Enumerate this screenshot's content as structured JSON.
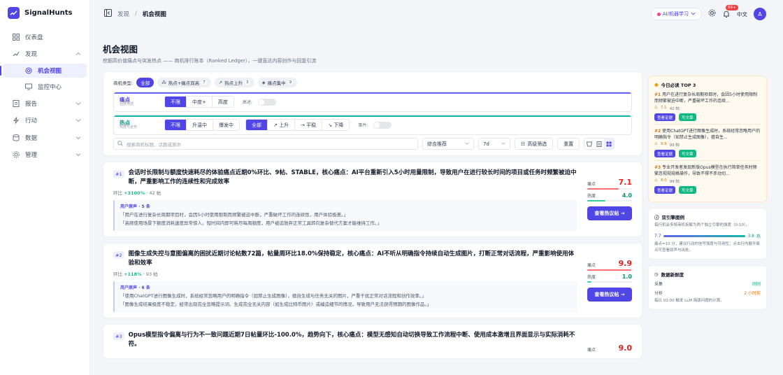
{
  "brand": {
    "name": "SignalHunts"
  },
  "sidebar": {
    "items": [
      {
        "label": "仪表盘",
        "icon": "grid-icon"
      },
      {
        "label": "发现",
        "icon": "trend-icon"
      },
      {
        "label": "机会视图",
        "icon": "target-icon"
      },
      {
        "label": "监控中心",
        "icon": "monitor-icon"
      },
      {
        "label": "报告",
        "icon": "report-icon"
      },
      {
        "label": "行动",
        "icon": "action-icon"
      },
      {
        "label": "数据",
        "icon": "database-icon"
      },
      {
        "label": "管理",
        "icon": "settings-icon"
      }
    ]
  },
  "topbar": {
    "crumb_parent": "发现",
    "crumb_sep": "/",
    "crumb_current": "机会视图",
    "topic": "AI/机器学习",
    "notif_count": "99+",
    "lang": "中文",
    "avatar": "A"
  },
  "page": {
    "title": "机会视图",
    "subtitle": "挖掘高价值痛点与突发热点 —— 商机排行账本（Ranked Ledger），一键直达内容创作与回复引流"
  },
  "filters": {
    "type_label": "商机类型:",
    "types": [
      {
        "label": "全部",
        "count": ""
      },
      {
        "label": "热点+痛点双高",
        "count": "7"
      },
      {
        "label": "热点上升",
        "count": "3"
      },
      {
        "label": "痛点集中",
        "count": "9"
      }
    ],
    "pain": {
      "title": "痛点",
      "sub": "强度筛选",
      "options": [
        "不限",
        "中度+",
        "高度"
      ],
      "toggle_label": "高述:",
      "toggle_text": "不限"
    },
    "hot": {
      "title": "热点",
      "sub": "热度与走势",
      "options": [
        "不限",
        "升温中",
        "爆发中"
      ],
      "trend": [
        "全部",
        "↗ 上升",
        "→ 平稳",
        "↘ 下降"
      ],
      "toggle_label": "事件:",
      "toggle_text": "不限"
    },
    "search_placeholder": "搜索商机标题、话题或原声",
    "sort": "综合推荐",
    "range": "7d",
    "advanced": "高级筛选",
    "reset": "重置"
  },
  "cards": [
    {
      "rank": "#1",
      "title": "会话时长限制与额度快速耗尽的体验痛点近期0%环比、9帖、STABLE，核心痛点：AI平台重新引入5小时用量限制，导致用户在进行较长时间的项目或任务时频繁被迫中断，严重影响工作的连续性和完成效率",
      "change_label": "环比",
      "change": "+3100%",
      "posts": "42 帖",
      "voices_title": "用户原声 · 5 条",
      "quotes": [
        "「用户在进行复杂长周期项目时，会因5小时使用限制而频繁被迫中断，严重破坏工作的连续性，用户体验极差。」",
        "「高频使用场景下额度消耗速度异常惊人。短时间内即可耗尽每周额度，用户被迫放弃正常工具转向复杂替代方案才能维持工作。」"
      ],
      "pain_label": "痛点",
      "pain": "7.1",
      "pain_pct": 71,
      "hot_label": "热度",
      "hot": "4.0",
      "hot_pct": 40,
      "cta": "查看热议帖 →"
    },
    {
      "rank": "#2",
      "title": "图像生成失控与意图偏离的困扰近期讨论帖数72篇，帖量周环比18.0%保持稳定，核心痛点：AI不听从明确指令持续自动生成图片，打断正常对话流程，严重影响使用体验和效率",
      "change_label": "环比",
      "change": "+118%",
      "posts": "93 帖",
      "voices_title": "用户原声 · 6 条",
      "quotes": [
        "「使用ChatGPT进行图像生成时，系统经常忽略用户的明确指令（如禁止生成图像），擅自生成与任务无关的图片，严重干扰正常对话流程和创作效率。」",
        "「图像生成结果极度不稳定，经常出现完全忽略提示词、生成完全无关内容（如生成比特币图片）或编造细节的情况，导致用户无法获得预期的图像作品。」"
      ],
      "pain_label": "痛点",
      "pain": "9.9",
      "pain_pct": 99,
      "hot_label": "热度",
      "hot": "1.0",
      "hot_pct": 10,
      "cta": "查看热议帖 →"
    },
    {
      "rank": "#3",
      "title": "Opus模型指令偏离与行为不一致问题近期7日帖量环比-100.0%，趋势向下，核心痛点：模型无感知自动切换导致工作流程中断、使用成本激增且界面显示与实际消耗不符。",
      "change_label": "",
      "change": "",
      "posts": "",
      "voices_title": "",
      "quotes": [],
      "pain_label": "痛点",
      "pain": "9.0",
      "pain_pct": 90,
      "hot_label": "",
      "hot": "",
      "hot_pct": 0,
      "cta": ""
    }
  ],
  "right": {
    "top3": {
      "title": "今日必读 TOP 3",
      "items": [
        {
          "rank": "#1",
          "text": "用户在进行复杂长周期项目时，会因5小时使用限制而频繁被迫中断，严重破坏工作的连续...",
          "pain": "7.1",
          "posts": "42 帖"
        },
        {
          "rank": "#2",
          "text": "使用ChatGPT进行图像生成时，系统经常忽略用户的明确指令（如禁止生成图像），擅自生...",
          "pain": "9.9",
          "posts": "93 帖"
        },
        {
          "rank": "#3",
          "text": "专业开发者发现新版Opus模型在执行简单任务时频繁忽视视规格操作，导致不得不手动切...",
          "pain": "8.0",
          "posts": "99 帖"
        }
      ],
      "btn_a": "查看证据",
      "btn_b": "写文章"
    },
    "dual": {
      "title": "双引擎图例",
      "desc": "每行机会多将商机拆解为两个独立引擎的强度（0-10）。",
      "left": "7.7",
      "right": "3.8",
      "right_unit": "热",
      "note": "痛点=10 分，建议行动的信号强度与可用性；点击行内展开痛点可查看原声与出处。"
    },
    "fresh": {
      "title": "数据新鲜度",
      "rows": [
        {
          "k": "采集",
          "v": "刚刚"
        },
        {
          "k": "分析",
          "v": "2 小时前"
        }
      ],
      "note": "每日 02:00 触发 LLM 简版问题的计算。"
    }
  },
  "colors": {
    "accent": "#4f46e5",
    "pain": "#dc2626",
    "hot": "#059669"
  }
}
